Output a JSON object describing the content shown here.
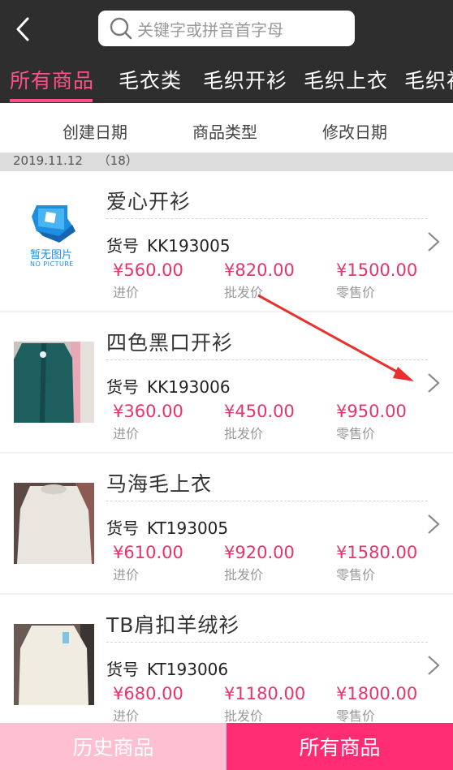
{
  "header": {
    "back_icon": "chevron-left-icon",
    "search_placeholder": "关键字或拼音首字母"
  },
  "category_tabs": [
    "所有商品",
    "毛衣类",
    "毛织开衫",
    "毛织上衣",
    "毛织衫"
  ],
  "active_category": "所有商品",
  "sort_options": [
    "创建日期",
    "商品类型",
    "修改日期"
  ],
  "group": {
    "date": "2019.11.12",
    "count": "（18）"
  },
  "price_labels": {
    "cost": "进价",
    "wholesale": "批发价",
    "retail": "零售价"
  },
  "sku_label": "货号",
  "placeholder_image": {
    "cn": "暂无图片",
    "en": "NO PICTURE"
  },
  "products": [
    {
      "name": "爱心开衫",
      "sku": "KK193005",
      "cost": "¥560.00",
      "wholesale": "¥820.00",
      "retail": "¥1500.00",
      "image": "no-picture"
    },
    {
      "name": "四色黑口开衫",
      "sku": "KK193006",
      "cost": "¥360.00",
      "wholesale": "¥450.00",
      "retail": "¥950.00",
      "image": "green-cardigan"
    },
    {
      "name": "马海毛上衣",
      "sku": "KT193005",
      "cost": "¥610.00",
      "wholesale": "¥920.00",
      "retail": "¥1580.00",
      "image": "white-sweater"
    },
    {
      "name": "TB肩扣羊绒衫",
      "sku": "KT193006",
      "cost": "¥680.00",
      "wholesale": "¥1180.00",
      "retail": "¥1800.00",
      "image": "cream-sweater"
    }
  ],
  "bottom_bar": {
    "history": "历史商品",
    "all": "所有商品"
  },
  "colors": {
    "accent": "#ff2c74",
    "header_bg": "#2e2e2e",
    "price": "#e8336b",
    "history_bg": "#ffbfd3"
  }
}
